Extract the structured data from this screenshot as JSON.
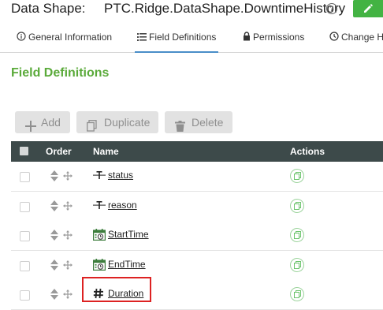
{
  "header": {
    "label": "Data Shape:",
    "name": "PTC.Ridge.DataShape.DowntimeHistory",
    "help_icon": "help-circle-icon",
    "edit_icon": "pencil-icon",
    "edit_color": "#43b343"
  },
  "tabs": [
    {
      "label": "General Information",
      "icon": "info-circle-icon",
      "active": false
    },
    {
      "label": "Field Definitions",
      "icon": "list-icon",
      "active": true
    },
    {
      "label": "Permissions",
      "icon": "lock-icon",
      "active": false
    },
    {
      "label": "Change H",
      "icon": "clock-icon",
      "active": false
    }
  ],
  "section": {
    "title": "Field Definitions",
    "title_color": "#5aaa3a"
  },
  "toolbar": {
    "add_label": "Add",
    "duplicate_label": "Duplicate",
    "delete_label": "Delete"
  },
  "table": {
    "columns": [
      "Order",
      "Name",
      "Actions"
    ],
    "header_color": "#3d4a4a",
    "rows": [
      {
        "name": "status",
        "type_icon": "text-type-icon"
      },
      {
        "name": "reason",
        "type_icon": "text-type-icon"
      },
      {
        "name": "StartTime",
        "type_icon": "calendar-icon"
      },
      {
        "name": "EndTime",
        "type_icon": "calendar-icon"
      },
      {
        "name": "Duration",
        "type_icon": "number-hash-icon"
      }
    ]
  }
}
